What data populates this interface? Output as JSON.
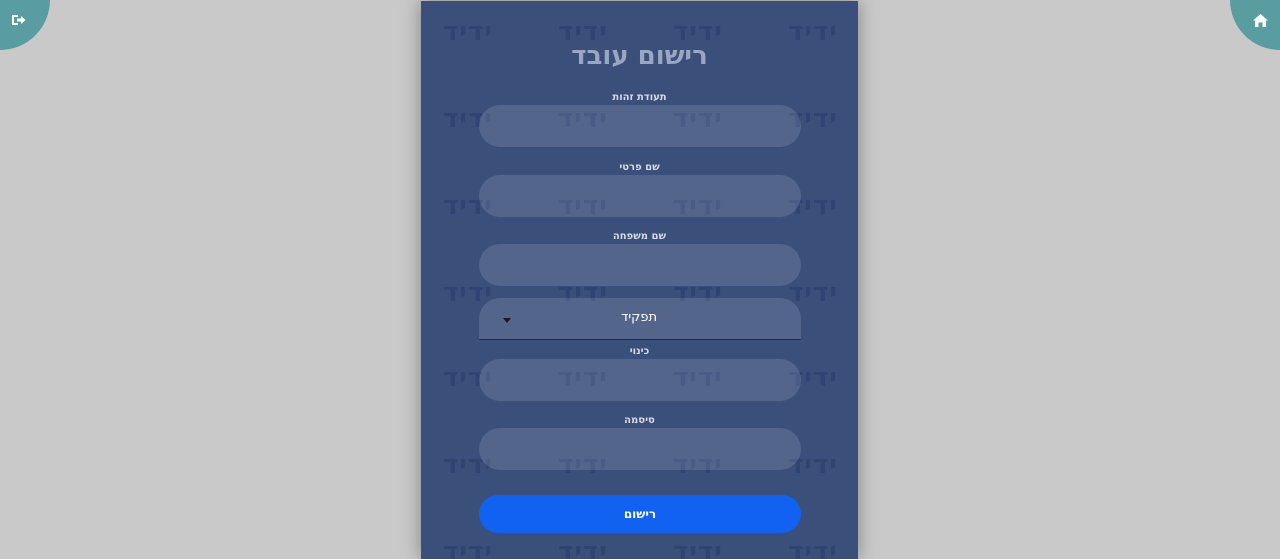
{
  "nav": {
    "logout_icon": "sign-out-icon",
    "home_icon": "home-icon"
  },
  "watermark": {
    "text": "ידיד"
  },
  "form": {
    "title": "רישום עובד",
    "fields": {
      "id_label": "תעודת זהות",
      "first_name_label": "שם פרטי",
      "last_name_label": "שם משפחה",
      "nickname_label": "כינוי",
      "password_label": "סיסמה"
    },
    "role_select": {
      "selected": "תפקיד"
    },
    "submit_label": "רישום"
  },
  "colors": {
    "panel": "#3a4f7a",
    "accent": "#5a9da0",
    "button": "#1162f0"
  }
}
